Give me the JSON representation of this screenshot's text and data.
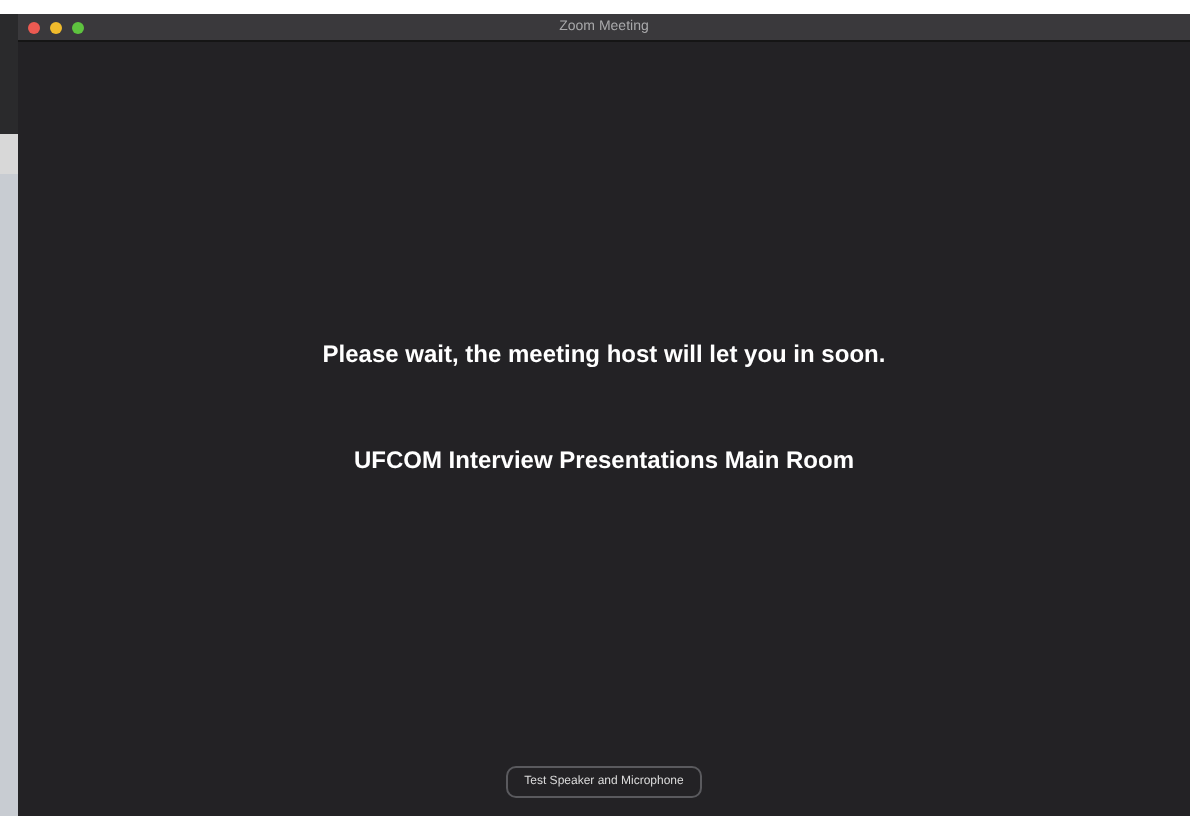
{
  "window": {
    "title": "Zoom Meeting"
  },
  "message": "Please wait, the meeting host will let you in soon.",
  "meeting_name": "UFCOM Interview Presentations Main Room",
  "buttons": [
    "Test Speaker and Microphone"
  ]
}
